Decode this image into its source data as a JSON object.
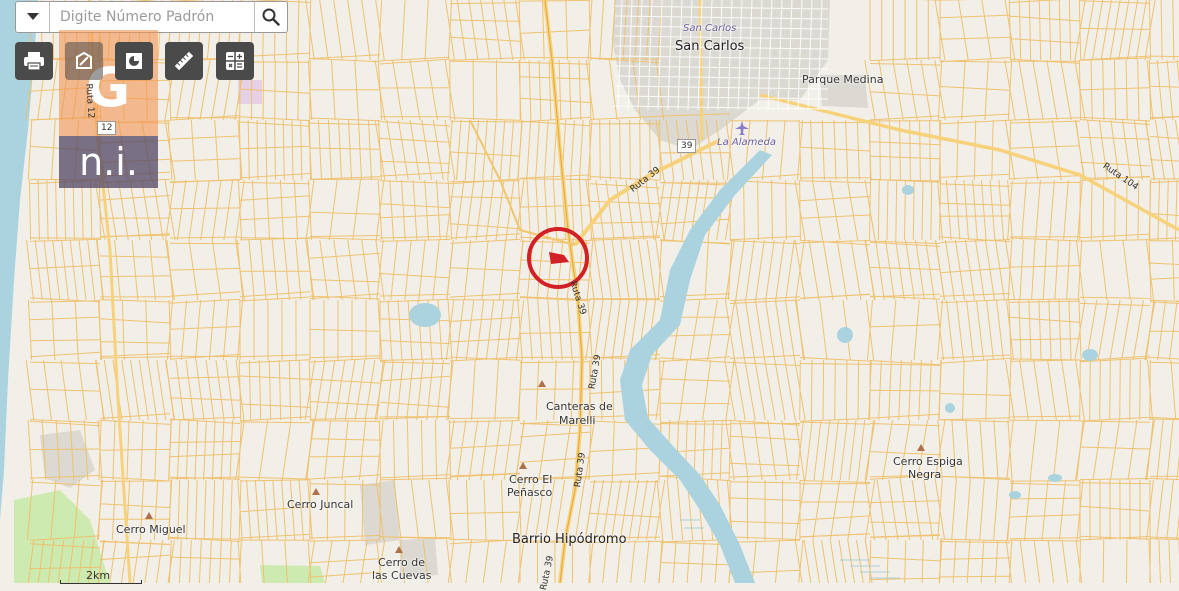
{
  "search": {
    "placeholder": "Digite Número Padrón"
  },
  "toolbar": {
    "tools": [
      {
        "name": "print-icon"
      },
      {
        "name": "identify-icon"
      },
      {
        "name": "layers-icon"
      },
      {
        "name": "measure-icon"
      },
      {
        "name": "calculator-icon"
      }
    ]
  },
  "logo": {
    "letter": "G",
    "text": "n.i."
  },
  "labels": {
    "san_carlos_small": "San Carlos",
    "san_carlos": "San Carlos",
    "parque_medina": "Parque Medina",
    "la_alameda": "La Alameda",
    "canteras_1": "Canteras de",
    "canteras_2": "Marelli",
    "cerro_el_1": "Cerro El",
    "cerro_el_2": "Peñasco",
    "cerro_juncal": "Cerro Juncal",
    "cerro_miguel": "Cerro Miguel",
    "cerro_de_1": "Cerro de",
    "cerro_de_2": "las Cuevas",
    "barrio": "Barrio Hipódromo",
    "espiga_1": "Cerro Espiga",
    "espiga_2": "Negra"
  },
  "roads": {
    "ruta39_a": "Ruta 39",
    "ruta39_b": "Ruta 39",
    "ruta39_c": "Ruta 39",
    "ruta39_d": "Ruta 39",
    "ruta39_e": "Ruta 39",
    "ruta104": "Ruta 104",
    "shield39": "39",
    "shield12": "12",
    "ruta_left": "Ruta 12"
  },
  "scale": "2km",
  "colors": {
    "parcel": "#efc06a",
    "land": "#f2efe9",
    "water": "#aad3df",
    "sea": "#aad3df",
    "urban": "#d9d6d0",
    "marker": "#d32027",
    "toolbar": "#4a4a4a"
  }
}
